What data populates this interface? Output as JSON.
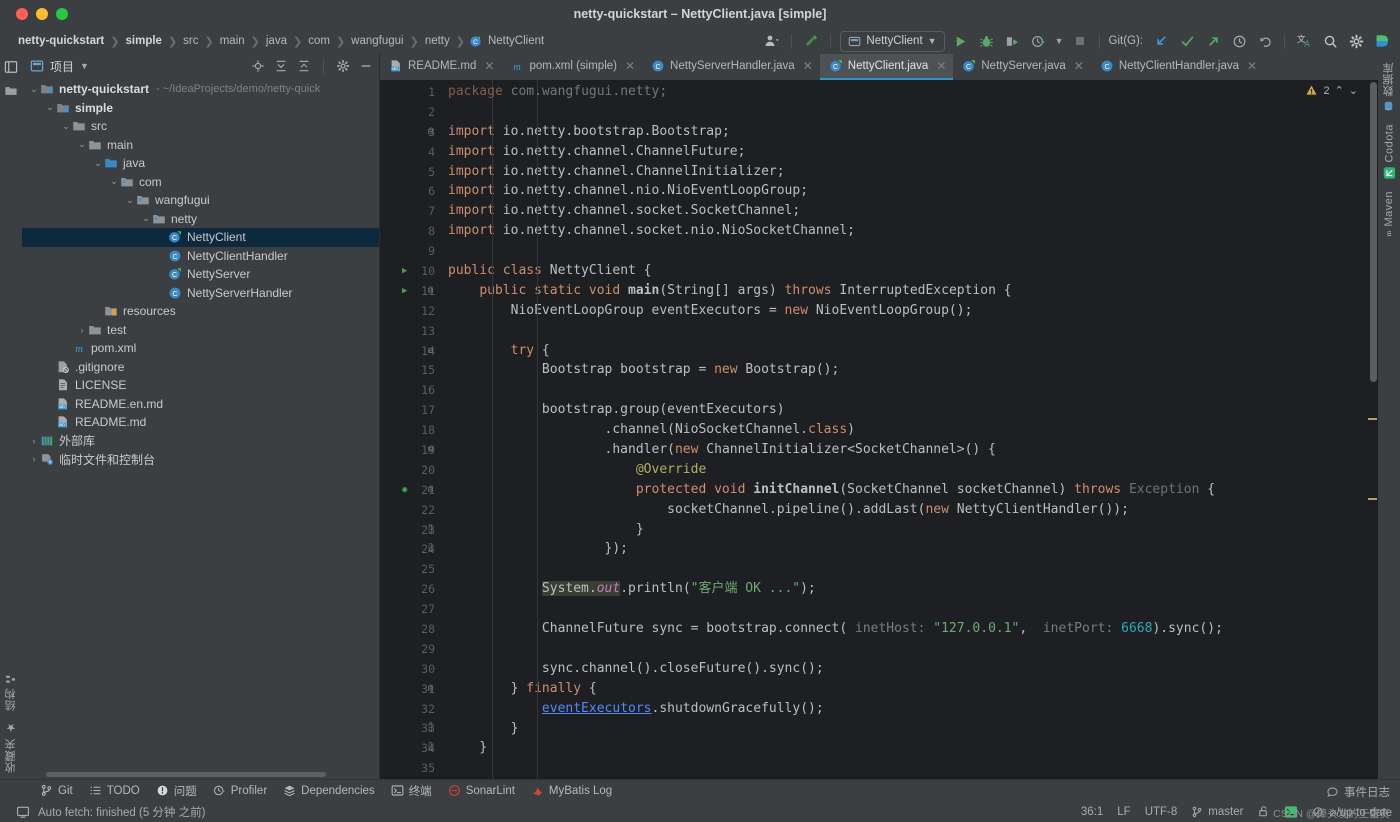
{
  "window": {
    "title": "netty-quickstart – NettyClient.java [simple]",
    "traffic_lights": [
      "close",
      "minimize",
      "zoom"
    ]
  },
  "breadcrumbs": [
    {
      "label": "netty-quickstart",
      "bold": true
    },
    {
      "label": "simple",
      "bold": true
    },
    {
      "label": "src",
      "bold": false
    },
    {
      "label": "main",
      "bold": false
    },
    {
      "label": "java",
      "bold": false
    },
    {
      "label": "com",
      "bold": false
    },
    {
      "label": "wangfugui",
      "bold": false
    },
    {
      "label": "netty",
      "bold": false
    },
    {
      "label": "NettyClient",
      "bold": false,
      "icon": "java-class-icon"
    }
  ],
  "toolbar": {
    "user_icon": "user-avatar-icon",
    "build_icon": "hammer-icon",
    "run_config": {
      "label": "NettyClient",
      "icon": "run-config-icon",
      "chevron": "▾"
    },
    "run_icon": "run-icon",
    "debug_icon": "debug-icon",
    "run_with_coverage_icon": "coverage-icon",
    "profiler_icon": "profiler-icon",
    "stop_icon": "stop-icon",
    "git_label": "Git(G):",
    "update_project_icon": "update-project-icon",
    "commit_icon": "commit-checkmark-icon",
    "push_icon": "push-arrow-icon",
    "history_icon": "history-clock-icon",
    "rollback_icon": "rollback-icon",
    "translate_icon": "translate-icon",
    "search_icon": "search-everywhere-icon",
    "settings_icon": "gear-icon",
    "ai_icon": "ai-assistant-icon"
  },
  "project_panel": {
    "title": "项目",
    "title_chevron": "▾",
    "actions": [
      "locate-icon",
      "expand-all-icon",
      "collapse-all-icon",
      "gear-icon",
      "hide-icon"
    ],
    "tree": [
      {
        "depth": 0,
        "arrow": "▾",
        "icon": "module-icon",
        "label": "netty-quickstart",
        "bold": true,
        "path": "- ~/IdeaProjects/demo/netty-quick",
        "selected": false
      },
      {
        "depth": 1,
        "arrow": "▾",
        "icon": "module-icon",
        "label": "simple",
        "bold": true,
        "path": "",
        "selected": false
      },
      {
        "depth": 2,
        "arrow": "▾",
        "icon": "folder-icon",
        "label": "src",
        "bold": false,
        "path": "",
        "selected": false
      },
      {
        "depth": 3,
        "arrow": "▾",
        "icon": "folder-icon",
        "label": "main",
        "bold": false,
        "path": "",
        "selected": false
      },
      {
        "depth": 4,
        "arrow": "▾",
        "icon": "source-folder-icon",
        "label": "java",
        "bold": false,
        "path": "",
        "selected": false
      },
      {
        "depth": 5,
        "arrow": "▾",
        "icon": "package-icon",
        "label": "com",
        "bold": false,
        "path": "",
        "selected": false
      },
      {
        "depth": 6,
        "arrow": "▾",
        "icon": "package-icon",
        "label": "wangfugui",
        "bold": false,
        "path": "",
        "selected": false
      },
      {
        "depth": 7,
        "arrow": "▾",
        "icon": "package-icon",
        "label": "netty",
        "bold": false,
        "path": "",
        "selected": false
      },
      {
        "depth": 8,
        "arrow": "",
        "icon": "java-runnable-class-icon",
        "label": "NettyClient",
        "bold": false,
        "path": "",
        "selected": true
      },
      {
        "depth": 8,
        "arrow": "",
        "icon": "java-class-icon",
        "label": "NettyClientHandler",
        "bold": false,
        "path": "",
        "selected": false
      },
      {
        "depth": 8,
        "arrow": "",
        "icon": "java-runnable-class-icon",
        "label": "NettyServer",
        "bold": false,
        "path": "",
        "selected": false
      },
      {
        "depth": 8,
        "arrow": "",
        "icon": "java-class-icon",
        "label": "NettyServerHandler",
        "bold": false,
        "path": "",
        "selected": false
      },
      {
        "depth": 4,
        "arrow": "",
        "icon": "resources-folder-icon",
        "label": "resources",
        "bold": false,
        "path": "",
        "selected": false
      },
      {
        "depth": 3,
        "arrow": "▸",
        "icon": "folder-icon",
        "label": "test",
        "bold": false,
        "path": "",
        "selected": false
      },
      {
        "depth": 2,
        "arrow": "",
        "icon": "maven-pom-icon",
        "label": "pom.xml",
        "bold": false,
        "path": "",
        "selected": false
      },
      {
        "depth": 1,
        "arrow": "",
        "icon": "gitignore-icon",
        "label": ".gitignore",
        "bold": false,
        "path": "",
        "selected": false
      },
      {
        "depth": 1,
        "arrow": "",
        "icon": "license-file-icon",
        "label": "LICENSE",
        "bold": false,
        "path": "",
        "selected": false
      },
      {
        "depth": 1,
        "arrow": "",
        "icon": "markdown-file-icon",
        "label": "README.en.md",
        "bold": false,
        "path": "",
        "selected": false
      },
      {
        "depth": 1,
        "arrow": "",
        "icon": "markdown-file-icon",
        "label": "README.md",
        "bold": false,
        "path": "",
        "selected": false
      },
      {
        "depth": 0,
        "arrow": "▸",
        "icon": "external-libraries-icon",
        "label": "外部库",
        "bold": false,
        "path": "",
        "selected": false
      },
      {
        "depth": 0,
        "arrow": "▸",
        "icon": "scratches-icon",
        "label": "临时文件和控制台",
        "bold": false,
        "path": "",
        "selected": false
      }
    ]
  },
  "left_rail": {
    "top_icons": [
      "project-tool-window-icon",
      "structure-folder-icon"
    ],
    "bottom_labels": [
      {
        "label": "结构",
        "icon": "structure-icon"
      },
      {
        "label": "收藏夹",
        "icon": "favorites-star-icon"
      }
    ]
  },
  "right_rail": {
    "labels": [
      {
        "label": "数据库",
        "icon": "database-icon"
      },
      {
        "label": "Codota",
        "icon": "codota-icon"
      },
      {
        "label": "Maven",
        "icon": "maven-icon"
      }
    ]
  },
  "editor_tabs": [
    {
      "label": "README.md",
      "icon": "markdown-file-icon",
      "active": false
    },
    {
      "label": "pom.xml (simple)",
      "icon": "maven-pom-icon",
      "active": false
    },
    {
      "label": "NettyServerHandler.java",
      "icon": "java-class-icon",
      "active": false
    },
    {
      "label": "NettyClient.java",
      "icon": "java-runnable-class-icon",
      "active": true
    },
    {
      "label": "NettyServer.java",
      "icon": "java-runnable-class-icon",
      "active": false
    },
    {
      "label": "NettyClientHandler.java",
      "icon": "java-class-icon",
      "active": false
    }
  ],
  "inspections": {
    "icon": "warning-triangle-icon",
    "count": "2",
    "prev": "⌃",
    "next": "⌄"
  },
  "code": {
    "first_visible_line": 1,
    "lines": [
      {
        "n": "1",
        "partial": true,
        "tokens": [
          {
            "t": "package",
            "c": "kw"
          },
          {
            "t": " com.wangfugui.netty;",
            "c": "plain"
          }
        ]
      },
      {
        "n": "2",
        "tokens": []
      },
      {
        "n": "3",
        "fold": "minus",
        "tokens": [
          {
            "t": "import",
            "c": "kw"
          },
          {
            "t": " io.netty.bootstrap.Bootstrap;",
            "c": "plain"
          }
        ]
      },
      {
        "n": "4",
        "tokens": [
          {
            "t": "import",
            "c": "kw"
          },
          {
            "t": " io.netty.channel.ChannelFuture;",
            "c": "plain"
          }
        ]
      },
      {
        "n": "5",
        "tokens": [
          {
            "t": "import",
            "c": "kw"
          },
          {
            "t": " io.netty.channel.ChannelInitializer;",
            "c": "plain"
          }
        ]
      },
      {
        "n": "6",
        "tokens": [
          {
            "t": "import",
            "c": "kw"
          },
          {
            "t": " io.netty.channel.nio.NioEventLoopGroup;",
            "c": "plain"
          }
        ]
      },
      {
        "n": "7",
        "tokens": [
          {
            "t": "import",
            "c": "kw"
          },
          {
            "t": " io.netty.channel.socket.SocketChannel;",
            "c": "plain"
          }
        ]
      },
      {
        "n": "8",
        "tokens": [
          {
            "t": "import",
            "c": "kw"
          },
          {
            "t": " io.netty.channel.socket.nio.NioSocketChannel;",
            "c": "plain"
          }
        ]
      },
      {
        "n": "9",
        "tokens": []
      },
      {
        "n": "10",
        "run": true,
        "tokens": [
          {
            "t": "public class",
            "c": "kw"
          },
          {
            "t": " NettyClient {",
            "c": "plain"
          }
        ]
      },
      {
        "n": "11",
        "run": true,
        "fold": "minus",
        "tokens": [
          {
            "t": "    ",
            "c": "plain"
          },
          {
            "t": "public static void",
            "c": "kw"
          },
          {
            "t": " ",
            "c": "plain"
          },
          {
            "t": "main",
            "c": "fn"
          },
          {
            "t": "(String[] args) ",
            "c": "plain"
          },
          {
            "t": "throws",
            "c": "kw"
          },
          {
            "t": " InterruptedException {",
            "c": "plain"
          }
        ]
      },
      {
        "n": "12",
        "tokens": [
          {
            "t": "        NioEventLoopGroup eventExecutors = ",
            "c": "plain"
          },
          {
            "t": "new",
            "c": "kw"
          },
          {
            "t": " NioEventLoopGroup();",
            "c": "plain"
          }
        ]
      },
      {
        "n": "13",
        "tokens": []
      },
      {
        "n": "14",
        "fold": "minus",
        "tokens": [
          {
            "t": "        ",
            "c": "plain"
          },
          {
            "t": "try",
            "c": "kw"
          },
          {
            "t": " {",
            "c": "plain"
          }
        ]
      },
      {
        "n": "15",
        "tokens": [
          {
            "t": "            Bootstrap bootstrap = ",
            "c": "plain"
          },
          {
            "t": "new",
            "c": "kw"
          },
          {
            "t": " Bootstrap();",
            "c": "plain"
          }
        ]
      },
      {
        "n": "16",
        "tokens": []
      },
      {
        "n": "17",
        "tokens": [
          {
            "t": "            bootstrap.group(eventExecutors)",
            "c": "plain"
          }
        ]
      },
      {
        "n": "18",
        "tokens": [
          {
            "t": "                    .channel(NioSocketChannel.",
            "c": "plain"
          },
          {
            "t": "class",
            "c": "kw"
          },
          {
            "t": ")",
            "c": "plain"
          }
        ]
      },
      {
        "n": "19",
        "fold": "minus",
        "tokens": [
          {
            "t": "                    .handler(",
            "c": "plain"
          },
          {
            "t": "new",
            "c": "kw"
          },
          {
            "t": " ChannelInitializer<SocketChannel>() {",
            "c": "plain"
          }
        ]
      },
      {
        "n": "20",
        "tokens": [
          {
            "t": "                        ",
            "c": "plain"
          },
          {
            "t": "@Override",
            "c": "ann"
          }
        ]
      },
      {
        "n": "21",
        "bulb": true,
        "fold": "minus",
        "tokens": [
          {
            "t": "                        ",
            "c": "plain"
          },
          {
            "t": "protected void",
            "c": "kw"
          },
          {
            "t": " ",
            "c": "plain"
          },
          {
            "t": "initChannel",
            "c": "fn"
          },
          {
            "t": "(SocketChannel socketChannel) ",
            "c": "plain"
          },
          {
            "t": "throws",
            "c": "kw"
          },
          {
            "t": " ",
            "c": "plain"
          },
          {
            "t": "Exception",
            "c": "err"
          },
          {
            "t": " {",
            "c": "plain"
          }
        ]
      },
      {
        "n": "22",
        "tokens": [
          {
            "t": "                            socketChannel.pipeline().addLast(",
            "c": "plain"
          },
          {
            "t": "new",
            "c": "kw"
          },
          {
            "t": " NettyClientHandler());",
            "c": "plain"
          }
        ]
      },
      {
        "n": "23",
        "fold": "end",
        "tokens": [
          {
            "t": "                        }",
            "c": "plain"
          }
        ]
      },
      {
        "n": "24",
        "fold": "end",
        "tokens": [
          {
            "t": "                    });",
            "c": "plain"
          }
        ]
      },
      {
        "n": "25",
        "tokens": []
      },
      {
        "n": "26",
        "tokens": [
          {
            "t": "            ",
            "c": "plain"
          },
          {
            "t": "System.",
            "c": "hl-plain"
          },
          {
            "t": "out",
            "c": "hl-field"
          },
          {
            "t": ".println(",
            "c": "plain"
          },
          {
            "t": "\"客户端 OK ...\"",
            "c": "str"
          },
          {
            "t": ");",
            "c": "plain"
          }
        ]
      },
      {
        "n": "27",
        "tokens": []
      },
      {
        "n": "28",
        "tokens": [
          {
            "t": "            ChannelFuture sync = bootstrap.connect( ",
            "c": "plain"
          },
          {
            "t": "inetHost:",
            "c": "hint"
          },
          {
            "t": " ",
            "c": "plain"
          },
          {
            "t": "\"127.0.0.1\"",
            "c": "str"
          },
          {
            "t": ",  ",
            "c": "plain"
          },
          {
            "t": "inetPort:",
            "c": "hint"
          },
          {
            "t": " ",
            "c": "plain"
          },
          {
            "t": "6668",
            "c": "num"
          },
          {
            "t": ").sync();",
            "c": "plain"
          }
        ]
      },
      {
        "n": "29",
        "tokens": []
      },
      {
        "n": "30",
        "tokens": [
          {
            "t": "            sync.channel().closeFuture().sync();",
            "c": "plain"
          }
        ]
      },
      {
        "n": "31",
        "fold": "minus",
        "tokens": [
          {
            "t": "        } ",
            "c": "plain"
          },
          {
            "t": "finally",
            "c": "kw"
          },
          {
            "t": " {",
            "c": "plain"
          }
        ]
      },
      {
        "n": "32",
        "tokens": [
          {
            "t": "            ",
            "c": "plain"
          },
          {
            "t": "eventExecutors",
            "c": "link"
          },
          {
            "t": ".shutdownGracefully();",
            "c": "plain"
          }
        ]
      },
      {
        "n": "33",
        "fold": "end",
        "tokens": [
          {
            "t": "        }",
            "c": "plain"
          }
        ]
      },
      {
        "n": "34",
        "fold": "end",
        "tokens": [
          {
            "t": "    }",
            "c": "plain"
          }
        ]
      },
      {
        "n": "35",
        "tokens": []
      }
    ]
  },
  "bottom_tool_windows": [
    {
      "label": "Git",
      "icon": "git-branch-icon"
    },
    {
      "label": "TODO",
      "icon": "todo-list-icon"
    },
    {
      "label": "问题",
      "icon": "problems-icon"
    },
    {
      "label": "Profiler",
      "icon": "profiler-icon"
    },
    {
      "label": "Dependencies",
      "icon": "dependencies-icon"
    },
    {
      "label": "终端",
      "icon": "terminal-icon"
    },
    {
      "label": "SonarLint",
      "icon": "sonarlint-icon"
    },
    {
      "label": "MyBatis Log",
      "icon": "mybatis-icon"
    }
  ],
  "status_bar": {
    "left_icon": "ide-message-icon",
    "message": "Auto fetch: finished (5 分钟 之前)",
    "caret_position": "36:1",
    "line_separator": "LF",
    "encoding": "UTF-8",
    "branch": "master",
    "branch_icon": "git-branch-icon",
    "lock_icon": "unlocked-icon",
    "terminal_icon": "terminal-green-icon",
    "sync_status": "⌀/up-to-date",
    "sync_icon": "no-sync-icon"
  },
  "event_log": {
    "label": "事件日志",
    "icon": "event-log-icon"
  },
  "watermark": "CSDN @掉头发的王富贵",
  "colors": {
    "accent_blue": "#3592c4",
    "selection_blue": "#0d293e",
    "editor_bg": "#1e1f22",
    "panel_bg": "#3c3f41",
    "keyword_orange": "#cf8e6d",
    "string_green": "#6aab73",
    "number_cyan": "#2aacb8",
    "annotation_olive": "#b3ae60",
    "warning_yellow": "#b8a557",
    "run_green": "#499c54"
  }
}
